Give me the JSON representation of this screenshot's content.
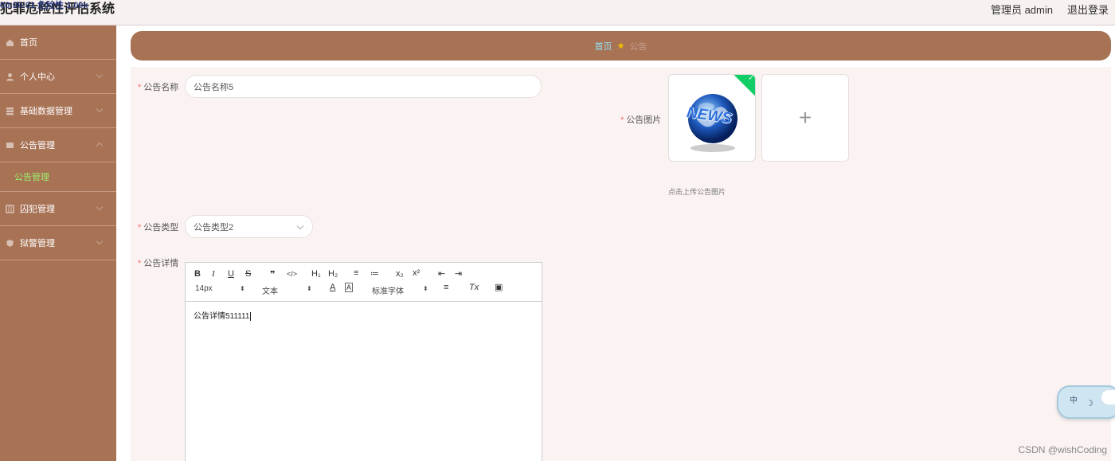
{
  "header": {
    "app_title": "犯罪危险性评估系统",
    "title_overlay": "00:00:01 危险性 1.00x",
    "user_label": "管理员 admin",
    "logout_label": "退出登录"
  },
  "sidebar": {
    "items": [
      {
        "label": "首页",
        "icon": "home-icon"
      },
      {
        "label": "个人中心",
        "icon": "user-icon"
      },
      {
        "label": "基础数据管理",
        "icon": "database-icon"
      },
      {
        "label": "公告管理",
        "icon": "notice-icon"
      }
    ],
    "active_sub": "公告管理",
    "items_after": [
      {
        "label": "囚犯管理",
        "icon": "prisoner-icon"
      },
      {
        "label": "狱警管理",
        "icon": "police-icon"
      }
    ]
  },
  "breadcrumb": {
    "home": "首页",
    "current": "公告"
  },
  "form": {
    "name_label": "公告名称",
    "name_value": "公告名称5",
    "image_label": "公告图片",
    "image_tip": "点击上传公告图片",
    "image_text": "NEWS",
    "type_label": "公告类型",
    "type_value": "公告类型2",
    "detail_label": "公告详情",
    "detail_value": "公告详情511111"
  },
  "editor_toolbar": {
    "bold": "B",
    "italic": "I",
    "underline": "U",
    "strike": "S",
    "quote": "❞",
    "code": "</>",
    "h1": "H₁",
    "h2": "H₂",
    "ordered_list": "≡",
    "bullet_list": "≔",
    "subscript": "x₂",
    "superscript": "x²",
    "outdent": "⇤",
    "indent": "⇥",
    "font_size": "14px",
    "text_style": "文本",
    "color": "A",
    "background": "A",
    "font_family": "标准字体",
    "align": "≡",
    "clear": "Tx",
    "image": "▣"
  },
  "ime": {
    "label": "中",
    "moon": "☽"
  },
  "watermark": "CSDN @wishCoding",
  "colors": {
    "sidebar": "#a87255",
    "active_sub": "#9cf06b",
    "breadcrumb_home": "#8fe1f5",
    "required": "#f56c6c",
    "check": "#13ce66"
  }
}
